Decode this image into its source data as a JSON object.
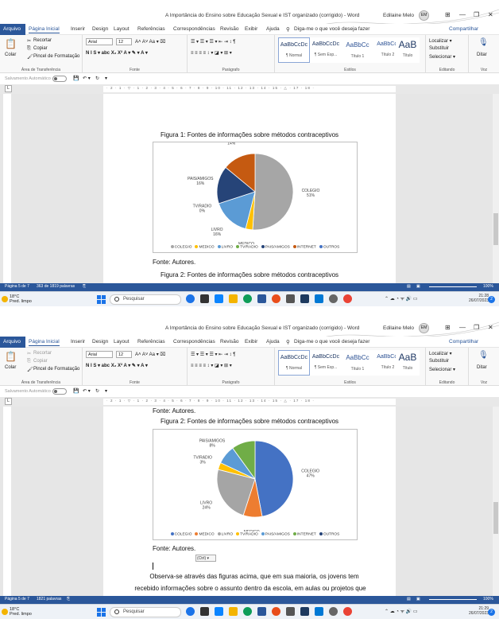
{
  "window": {
    "title": "A Importância do Ensino sobre Educação Sexual e IST organizado (corrigido) - Word",
    "user": "Edilaine Melo",
    "avatar_initials": "EM",
    "minimize": "—",
    "restore": "❐",
    "close": "✕"
  },
  "menu": {
    "arquivo": "Arquivo",
    "tabs": [
      "Página Inicial",
      "Inserir",
      "Design",
      "Layout",
      "Referências",
      "Correspondências",
      "Revisão",
      "Exibir",
      "Ajuda"
    ],
    "tellme": "Diga-me o que você deseja fazer",
    "share": "Compartilhar"
  },
  "ribbon": {
    "clipboard": {
      "paste": "Colar",
      "cut": "Recortar",
      "copy": "Copiar",
      "format_painter": "Pincel de Formatação",
      "label": "Área de Transferência"
    },
    "font": {
      "name": "Arial",
      "size": "12",
      "label": "Fonte",
      "row1": "A˄ A˅ Aa ▾ ⌧",
      "row2": "N I S ▾ abc X₂ X² A ▾ ✎ ▾ A ▾"
    },
    "paragraph": {
      "label": "Parágrafo",
      "row1": "☰ ▾ ☰ ▾ ☰ ▾  ⇤ ⇥  ↕  ¶",
      "row2": "≡ ≡ ≡ ≡  ↕ ▾  ◪ ▾  ⊞ ▾"
    },
    "styles": {
      "label": "Estilos",
      "items": [
        {
          "sample": "AaBbCcDc",
          "name": "¶ Normal"
        },
        {
          "sample": "AaBbCcDc",
          "name": "¶ Sem Esp..."
        },
        {
          "sample": "AaBbCc",
          "name": "Título 1"
        },
        {
          "sample": "AaBbCcI",
          "name": "Título 2"
        },
        {
          "sample": "AaB",
          "name": "Título"
        }
      ]
    },
    "editing": {
      "label": "Editando",
      "find": "Localizar ▾",
      "replace": "Substituir",
      "select": "Selecionar ▾"
    },
    "voice": {
      "label": "Voz",
      "dictate": "Ditar"
    }
  },
  "quickaccess": {
    "autosave": "Salvamento Automático",
    "toggle_state": "off"
  },
  "ruler": {
    "text": "· 2 · 1 · ▽ · 1 · 2 · 3 · 4 · 5 · 6 · 7 · 8 · 9 · 10 · 11 · 12 · 13 · 14 · 15 · △ · 17 · 18 ·"
  },
  "status": {
    "page1": "Página 5 de 7",
    "words1": "363 de 1819 palavras",
    "page2": "Página 5 de 7",
    "words2": "1821 palavras",
    "zoom": "100%"
  },
  "taskbar": {
    "temp": "18°C",
    "weather": "Pred. limpo",
    "search": "Pesquisar",
    "time1": "21:28",
    "time2": "21:29",
    "date": "26/07/2023",
    "notifications": "2",
    "tray": "⌃  ☁  ◔  ᯤ  🔊  ▭"
  },
  "doc1": {
    "caption_top": "Figura 1: Fontes de informações sobre métodos contraceptivos",
    "fonte": "Fonte: Autores.",
    "caption_bottom": "Figura 2: Fontes de informações sobre métodos contraceptivos"
  },
  "doc2": {
    "fonte_top": "Fonte: Autores.",
    "caption": "Figura 2: Fontes de informações sobre métodos contraceptivos",
    "fonte": "Fonte: Autores.",
    "paste_options": "(Ctrl) ▾",
    "para_line1": "Observa-se através das figuras acima, que em sua maioria, os jovens tem",
    "para_line2": "recebido informações sobre o assunto dentro da escola, em aulas ou projetos que"
  },
  "chart_data": [
    {
      "type": "pie",
      "title": "",
      "categories": [
        "COLEGIO",
        "MEDICO",
        "LIVRO",
        "TV/RADIO",
        "PAIS/AMIGOS",
        "INTERNET",
        "OUTROS"
      ],
      "values": [
        51,
        3,
        16,
        0,
        16,
        14,
        0
      ],
      "labels": [
        "COLEGIO\n51%",
        "MEDICO\n3%",
        "LIVRO\n16%",
        "TV/RADIO\n0%",
        "PAIS/AMIGOS\n16%",
        "INTERNET\n14%",
        "OUTROS\n0%"
      ],
      "colors": [
        "#a6a6a6",
        "#ffc000",
        "#5b9bd5",
        "#70ad47",
        "#264478",
        "#c55a11",
        "#4472c4"
      ],
      "legend": "bottom"
    },
    {
      "type": "pie",
      "title": "",
      "categories": [
        "COLEGIO",
        "MEDICO",
        "LIVRO",
        "TV/RADIO",
        "PAIS/AMIGOS",
        "INTERNET",
        "OUTROS"
      ],
      "values": [
        47,
        8,
        24,
        3,
        8,
        10,
        0
      ],
      "labels": [
        "COLEGIO\n47%",
        "MEDICO\n8%",
        "LIVRO\n24%",
        "TV/RADIO\n3%",
        "PAIS/AMIGOS\n8%",
        "INTERNET\n10%",
        "OUTROS\n0%"
      ],
      "colors": [
        "#4472c4",
        "#ed7d31",
        "#a5a5a5",
        "#ffc000",
        "#5b9bd5",
        "#70ad47",
        "#264478"
      ],
      "legend": "bottom"
    }
  ],
  "colors": {
    "accent": "#2b579a"
  }
}
